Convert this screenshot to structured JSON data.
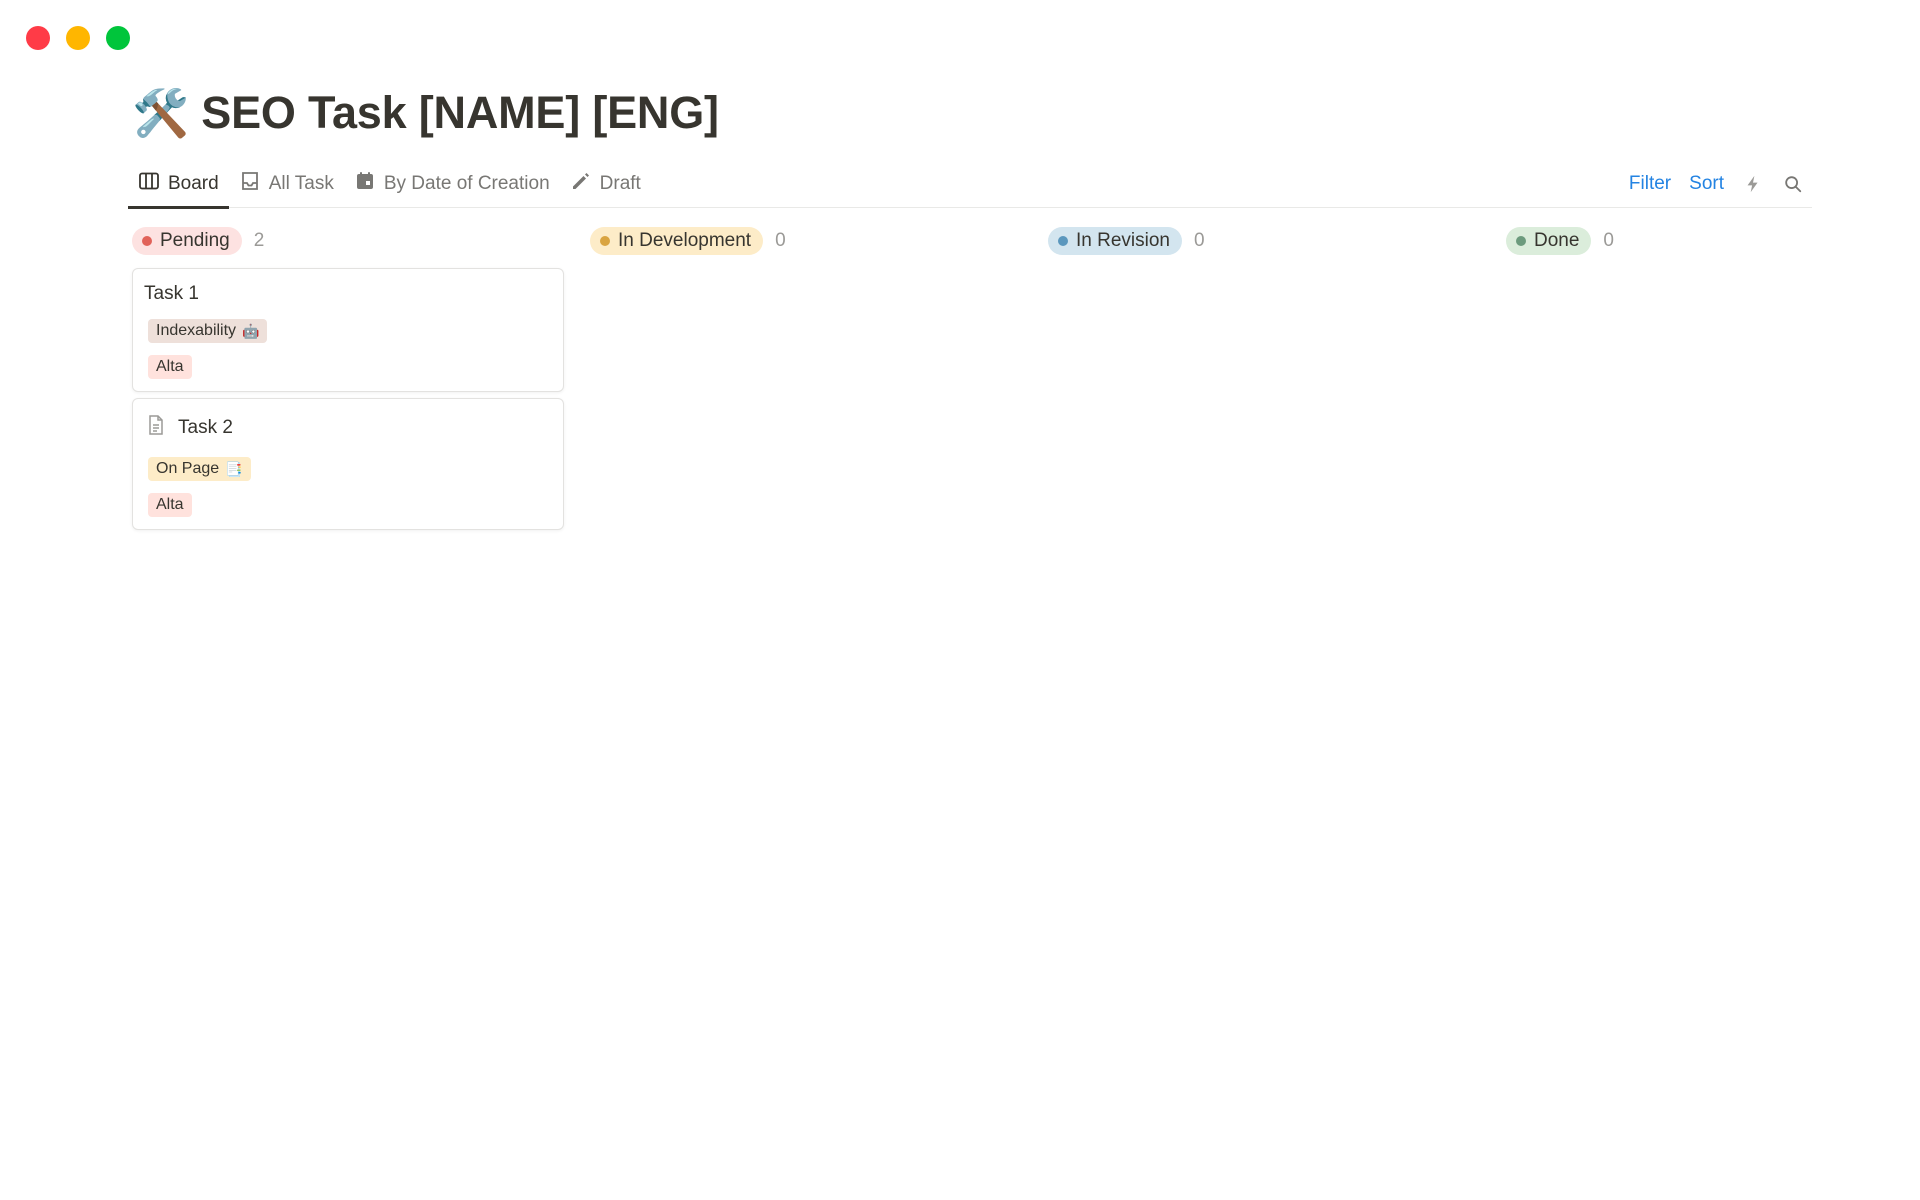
{
  "window": {
    "controls": [
      "close",
      "minimize",
      "maximize"
    ]
  },
  "page": {
    "icon": "🛠️",
    "title": "SEO Task [NAME] [ENG]"
  },
  "tabs": [
    {
      "label": "Board",
      "icon": "board-icon",
      "active": true
    },
    {
      "label": "All Task",
      "icon": "inbox-icon",
      "active": false
    },
    {
      "label": "By Date of Creation",
      "icon": "calendar-icon",
      "active": false
    },
    {
      "label": "Draft",
      "icon": "pencil-icon",
      "active": false
    }
  ],
  "actions": {
    "filter": "Filter",
    "sort": "Sort",
    "automation_icon": "lightning-icon",
    "search_icon": "search-icon"
  },
  "columns": [
    {
      "label": "Pending",
      "count": "2",
      "bg": "#fde2e1",
      "dot": "#e16259"
    },
    {
      "label": "In Development",
      "count": "0",
      "bg": "#fdecc8",
      "dot": "#d9a441"
    },
    {
      "label": "In Revision",
      "count": "0",
      "bg": "#d3e5ef",
      "dot": "#5b97bd"
    },
    {
      "label": "Done",
      "count": "0",
      "bg": "#dbeddb",
      "dot": "#6c9b7d"
    }
  ],
  "cards": [
    {
      "title": "Task 1",
      "category": "Indexability",
      "category_emoji": "🤖",
      "category_bg": "#eee0da",
      "priority": "Alta",
      "priority_bg": "#ffe2dd"
    },
    {
      "title": "Task 2",
      "category": "On Page",
      "category_emoji": "📑",
      "category_bg": "#fdecc8",
      "priority": "Alta",
      "priority_bg": "#ffe2dd"
    }
  ]
}
